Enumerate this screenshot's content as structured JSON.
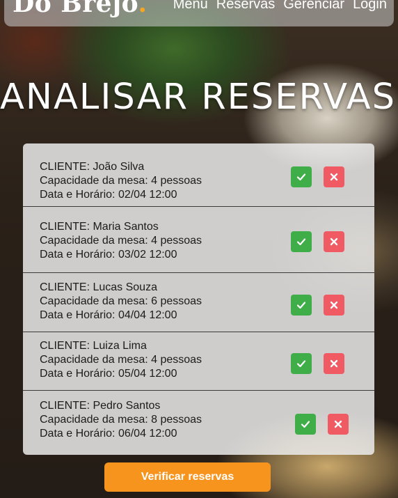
{
  "nav": {
    "logo_text": "Do Brejo",
    "logo_dot": ".",
    "accent_color": "#f5a623",
    "links": [
      "Menu",
      "Reservas",
      "Gerenciar",
      "Login"
    ]
  },
  "page_title": "ANALISAR RESERVAS",
  "reservations": [
    {
      "client": "CLIENTE: João Silva",
      "capacity": "Capacidade da mesa: 4 pessoas",
      "datetime": "Data e Horário: 02/04 12:00"
    },
    {
      "client": "CLIENTE: Maria Santos",
      "capacity": "Capacidade da mesa: 4 pessoas",
      "datetime": "Data e Horário: 03/02 12:00"
    },
    {
      "client": "CLIENTE: Lucas Souza",
      "capacity": "Capacidade da mesa: 6 pessoas",
      "datetime": "Data e Horário: 04/04 12:00"
    },
    {
      "client": "CLIENTE: Luiza Lima",
      "capacity": "Capacidade da mesa: 4 pessoas",
      "datetime": "Data e Horário: 05/04 12:00"
    },
    {
      "client": "CLIENTE: Pedro Santos",
      "capacity": "Capacidade da mesa: 8 pessoas",
      "datetime": "Data e Horário: 06/04 12:00"
    }
  ],
  "actions": {
    "accept_icon": "check-icon",
    "reject_icon": "close-icon",
    "accept_color": "#3fae49",
    "reject_color": "#f05a63"
  },
  "verify_button_label": "Verificar reservas",
  "verify_button_color": "#f7941d"
}
